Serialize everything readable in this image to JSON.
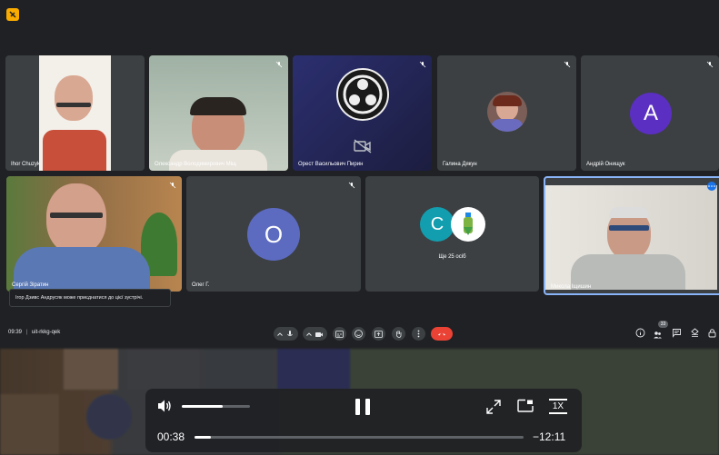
{
  "meeting": {
    "time": "09:39",
    "separator": "|",
    "code": "uit-rkkg-qek"
  },
  "colors": {
    "bg": "#202124",
    "tile": "#3c4043",
    "accent": "#8ab4f8",
    "end_call": "#ea4335"
  },
  "participants": [
    {
      "name": "Ihor Chuzyk",
      "muted": false
    },
    {
      "name": "Олександр Володимирович Міщ",
      "muted": true
    },
    {
      "name": "Орест Васильович Пирин",
      "muted": true,
      "camera_off_icon": "video-off-icon"
    },
    {
      "name": "Галина Дякун",
      "muted": true
    },
    {
      "name": "Андрій Онищук",
      "muted": true,
      "initial": "A",
      "color": "#5b2fc2"
    },
    {
      "name": "Сергій Зіратин",
      "muted": true
    },
    {
      "name": "Олег Г.",
      "muted": true,
      "initial": "O",
      "color": "#5c6bc0"
    },
    {
      "name": "Ще 25 осіб",
      "muted": false,
      "initial": "C",
      "color": "#129eaf"
    },
    {
      "name": "Микола Іщишин",
      "muted": false,
      "active_speaker": true
    }
  ],
  "notification": "Iгор Дзивс Андрусяк може приєднатися до цієї зустрічі.",
  "people_count": "33",
  "player": {
    "current_time": "00:38",
    "remaining_time": "−12:11",
    "speed": "1X",
    "progress": 0.05,
    "volume": 0.6
  }
}
